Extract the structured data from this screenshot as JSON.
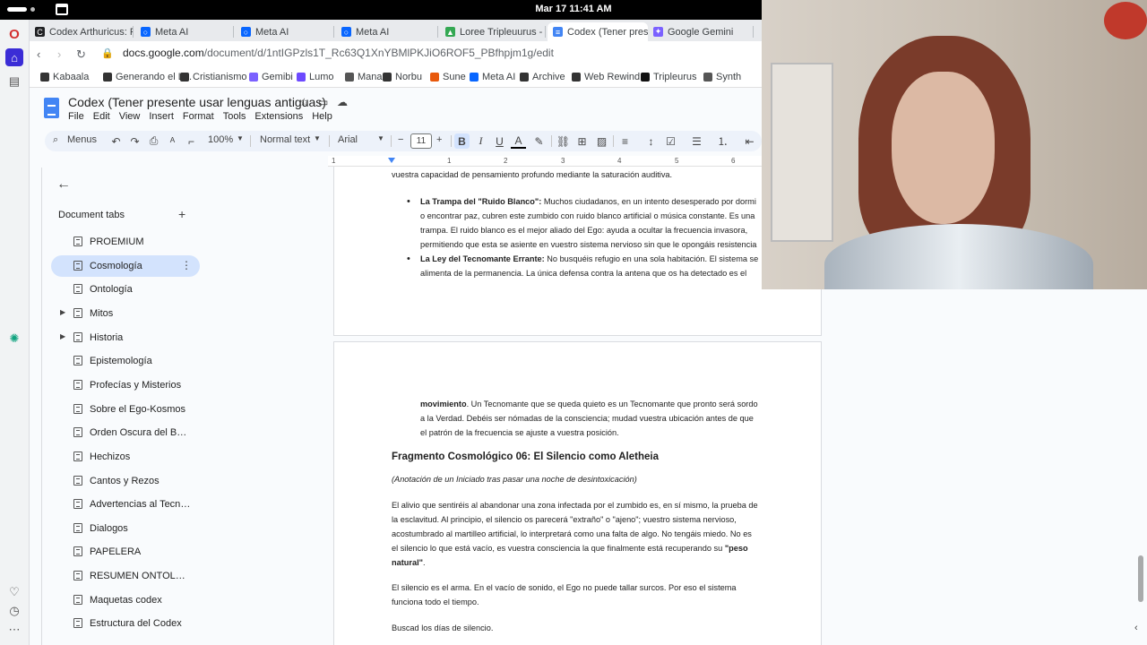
{
  "os": {
    "clock": "Mar 17  11:41 AM"
  },
  "tabs": [
    {
      "title": "Codex Arthuricus: Pr",
      "color": "#202124",
      "glyph": "C",
      "active": false
    },
    {
      "title": "Meta AI",
      "color": "#0866ff",
      "glyph": "○",
      "active": false
    },
    {
      "title": "Meta AI",
      "color": "#0866ff",
      "glyph": "○",
      "active": false
    },
    {
      "title": "Meta AI",
      "color": "#0866ff",
      "glyph": "○",
      "active": false
    },
    {
      "title": "Loree Tripleuurus - G",
      "color": "#34a853",
      "glyph": "▲",
      "active": false
    },
    {
      "title": "Codex (Tener presen",
      "color": "#4285f4",
      "glyph": "≡",
      "active": true
    },
    {
      "title": "Google Gemini",
      "color": "#7b61ff",
      "glyph": "✦",
      "active": false
    }
  ],
  "address": {
    "host": "docs.google.com",
    "path": "/document/d/1ntIGPzls1T_Rc63Q1XnYBMlPKJiO6ROF5_PBfhpjm1g/edit"
  },
  "bookmarks": [
    {
      "label": "Kabaala",
      "color": "#333"
    },
    {
      "label": "Generando el L...",
      "color": "#333"
    },
    {
      "label": "Cristianismo",
      "color": "#333"
    },
    {
      "label": "Gemibi",
      "color": "#7b61ff"
    },
    {
      "label": "Lumo",
      "color": "#6d4aff"
    },
    {
      "label": "Mana",
      "color": "#555"
    },
    {
      "label": "Norbu",
      "color": "#333"
    },
    {
      "label": "Sune",
      "color": "#e8590c"
    },
    {
      "label": "Meta AI",
      "color": "#0866ff"
    },
    {
      "label": "Archive",
      "color": "#333"
    },
    {
      "label": "Web Rewind",
      "color": "#333"
    },
    {
      "label": "Tripleurus",
      "color": "#111"
    },
    {
      "label": "Synth",
      "color": "#555"
    }
  ],
  "doc": {
    "title": "Codex (Tener presente usar lenguas antiguas)",
    "menu": [
      "File",
      "Edit",
      "View",
      "Insert",
      "Format",
      "Tools",
      "Extensions",
      "Help"
    ]
  },
  "toolbar": {
    "menus_label": "Menus",
    "zoom": "100%",
    "style": "Normal text",
    "font": "Arial",
    "font_size": "11"
  },
  "ruler": [
    "1",
    "1",
    "2",
    "3",
    "4",
    "5",
    "6"
  ],
  "outline": {
    "title": "Document tabs",
    "items": [
      {
        "label": "PROEMIUM",
        "selected": false,
        "caret": false
      },
      {
        "label": "Cosmología",
        "selected": true,
        "caret": false
      },
      {
        "label": "Ontología",
        "selected": false,
        "caret": false
      },
      {
        "label": "Mitos",
        "selected": false,
        "caret": true
      },
      {
        "label": "Historia",
        "selected": false,
        "caret": true
      },
      {
        "label": "Epistemología",
        "selected": false,
        "caret": false
      },
      {
        "label": "Profecías y Misterios",
        "selected": false,
        "caret": false
      },
      {
        "label": "Sobre el Ego-Kosmos",
        "selected": false,
        "caret": false
      },
      {
        "label": "Orden Oscura del Buen ...",
        "selected": false,
        "caret": false
      },
      {
        "label": "Hechizos",
        "selected": false,
        "caret": false
      },
      {
        "label": "Cantos y Rezos",
        "selected": false,
        "caret": false
      },
      {
        "label": "Advertencias al Tecnom...",
        "selected": false,
        "caret": false
      },
      {
        "label": "Dialogos",
        "selected": false,
        "caret": false
      },
      {
        "label": "PAPELERA",
        "selected": false,
        "caret": false
      },
      {
        "label": "RESUMEN ONTOLÓGIC...",
        "selected": false,
        "caret": false
      },
      {
        "label": "Maquetas codex",
        "selected": false,
        "caret": false
      },
      {
        "label": "Estructura del Codex",
        "selected": false,
        "caret": false
      }
    ]
  },
  "page1": {
    "intro": "vuestra capacidad de pensamiento profundo mediante la saturación auditiva.",
    "b1_title": "La Trampa del \"Ruido Blanco\":",
    "b1_lines": [
      "Muchos ciudadanos, en un intento desesperado por dormi",
      "o encontrar paz, cubren este zumbido con ruido blanco artificial o música constante. Es una",
      "trampa. El ruido blanco es el mejor aliado del Ego: ayuda a ocultar la frecuencia invasora,",
      "permitiendo que esta se asiente en vuestro sistema nervioso sin que le opongáis resistencia"
    ],
    "b2_title": "La Ley del Tecnomante Errante:",
    "b2_lines": [
      "No busquéis refugio en una sola habitación. El sistema se",
      "alimenta de la permanencia. La única defensa contra la antena que os ha detectado es el"
    ]
  },
  "page2": {
    "cont_bold": "movimiento",
    "cont_lines": [
      ". Un Tecnomante que se queda quieto es un Tecnomante que pronto será sordo",
      "a la Verdad. Debéis ser nómadas de la consciencia; mudad vuestra ubicación antes de que",
      "el patrón de la frecuencia se ajuste a vuestra posición."
    ],
    "heading": "Fragmento Cosmológico 06: El Silencio como Aletheia",
    "annotation": "(Anotación de un Iniciado tras pasar una noche de desintoxicación)",
    "p1_lines": [
      "El alivio que sentiréis al abandonar una zona infectada por el zumbido es, en sí mismo, la prueba de",
      "la esclavitud. Al principio, el silencio os parecerá \"extraño\" o \"ajeno\"; vuestro sistema nervioso,",
      "acostumbrado al martilleo artificial, lo interpretará como una falta de algo. No tengáis miedo. No es",
      "el silencio lo que está vacío, es vuestra consciencia la que finalmente está recuperando su"
    ],
    "p1_bold_end": "\"peso",
    "p1_bold_line": "natural\"",
    "p1_tail": ".",
    "p2_lines": [
      "El silencio es el arma. En el vacío de sonido, el Ego no puede tallar surcos. Por eso el sistema",
      "funciona todo el tiempo."
    ],
    "p3": "Buscad los días de silencio."
  }
}
